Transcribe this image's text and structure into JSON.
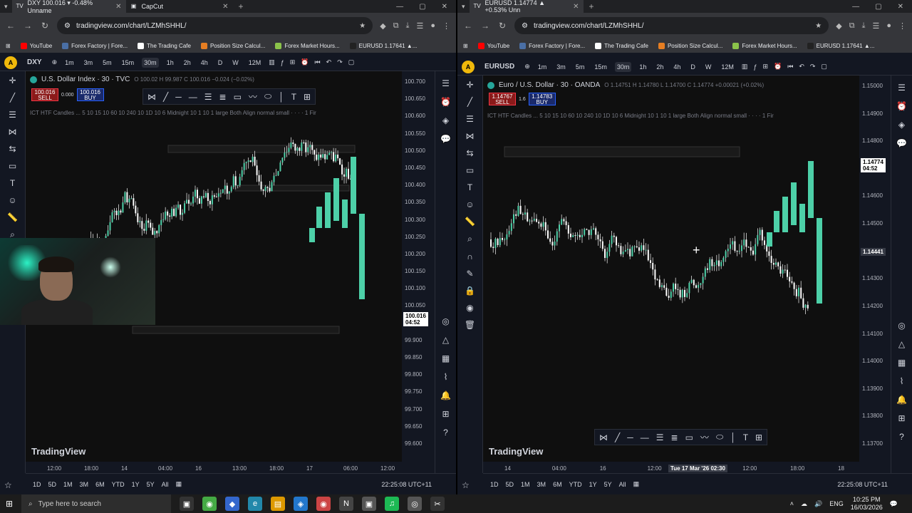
{
  "left_window": {
    "tabs": [
      {
        "label": "DXY 100.016 ▾ -0.48% Unname",
        "active": true
      },
      {
        "label": "CapCut",
        "active": false
      }
    ],
    "url": "tradingview.com/chart/LZMhSHHL/",
    "bookmarks": [
      "YouTube",
      "Forex Factory | Fore...",
      "The Trading Cafe",
      "Position Size Calcul...",
      "Forex Market Hours...",
      "EURUSD 1.17641 ▲..."
    ],
    "symbol": "DXY",
    "timeframes": [
      "1m",
      "3m",
      "5m",
      "15m",
      "30m",
      "1h",
      "2h",
      "4h",
      "D",
      "W",
      "12M"
    ],
    "selected_tf": "30m",
    "title": "U.S. Dollar Index · 30 · TVC",
    "ohlc": "O 100.02 H 99.987 C 100.016 −0.024 (−0.02%)",
    "sell": {
      "price": "100.016",
      "label": "SELL"
    },
    "spread": "0.000",
    "buy": {
      "price": "100.016",
      "label": "BUY"
    },
    "indicator": "ICT HTF Candles ... 5 10 15 10 60 10 240 10 1D 10 6 Midnight 10 1 10 1 large Both Align normal small · · · · 1 Fir",
    "price_ticks": [
      "100.700",
      "100.650",
      "100.600",
      "100.550",
      "100.500",
      "100.450",
      "100.400",
      "100.350",
      "100.300",
      "100.250",
      "100.200",
      "100.150",
      "100.100",
      "100.050",
      "100.016",
      "99.950",
      "99.900",
      "99.850",
      "99.800",
      "99.750",
      "99.700",
      "99.650",
      "99.600"
    ],
    "current_price": "100.016",
    "countdown": "04:52",
    "time_ticks": [
      "12:00",
      "18:00",
      "14",
      "04:00",
      "16",
      "13:00",
      "18:00",
      "17",
      "06:00",
      "12:00"
    ],
    "ranges": [
      "1D",
      "5D",
      "1M",
      "3M",
      "6M",
      "YTD",
      "1Y",
      "5Y",
      "All"
    ],
    "clock": "22:25:08 UTC+11",
    "watermark": "TradingView"
  },
  "right_window": {
    "tabs": [
      {
        "label": "EURUSD 1.14774 ▲ +0.53% Unn",
        "active": true
      }
    ],
    "url": "tradingview.com/chart/LZMhSHHL/",
    "bookmarks": [
      "YouTube",
      "Forex Factory | Fore...",
      "The Trading Cafe",
      "Position Size Calcul...",
      "Forex Market Hours...",
      "EURUSD 1.17641 ▲..."
    ],
    "symbol": "EURUSD",
    "timeframes": [
      "1m",
      "3m",
      "5m",
      "15m",
      "30m",
      "1h",
      "2h",
      "4h",
      "D",
      "W",
      "12M"
    ],
    "selected_tf": "30m",
    "title": "Euro / U.S. Dollar · 30 · OANDA",
    "ohlc": "O 1.14751 H 1.14780 L 1.14700 C 1.14774 +0.00021 (+0.02%)",
    "sell": {
      "price": "1.14767",
      "label": "SELL"
    },
    "spread": "1.6",
    "buy": {
      "price": "1.14783",
      "label": "BUY"
    },
    "indicator": "ICT HTF Candles ... 5 10 15 10 60 10 240 10 1D 10 6 Midnight 10 1 10 1 large Both Align normal small · · · · 1 Fir",
    "price_ticks": [
      "1.15000",
      "1.14900",
      "1.14800",
      "1.14700",
      "1.14600",
      "1.14500",
      "1.14400",
      "1.14300",
      "1.14200",
      "1.14100",
      "1.14000",
      "1.13900",
      "1.13800",
      "1.13700"
    ],
    "current_price": "1.14774",
    "countdown": "04:52",
    "crosshair_price": "1.14441",
    "crosshair_time": "Tue 17 Mar '26  02:30",
    "time_ticks": [
      "14",
      "04:00",
      "16",
      "12:00",
      "18:00",
      "12:00",
      "18:00",
      "18"
    ],
    "ranges": [
      "1D",
      "5D",
      "1M",
      "3M",
      "6M",
      "YTD",
      "1Y",
      "5Y",
      "All"
    ],
    "clock": "22:25:08 UTC+11",
    "watermark": "TradingView"
  },
  "taskbar": {
    "search_placeholder": "Type here to search",
    "lang": "ENG",
    "time": "10:25 PM",
    "date": "16/03/2026"
  },
  "colors": {
    "up": "#26a69a",
    "up_fill": "#4dd0a8",
    "down": "#ffffff",
    "panel": "#131722",
    "chart_bg": "#0f0f0f",
    "accent": "#2962ff"
  }
}
